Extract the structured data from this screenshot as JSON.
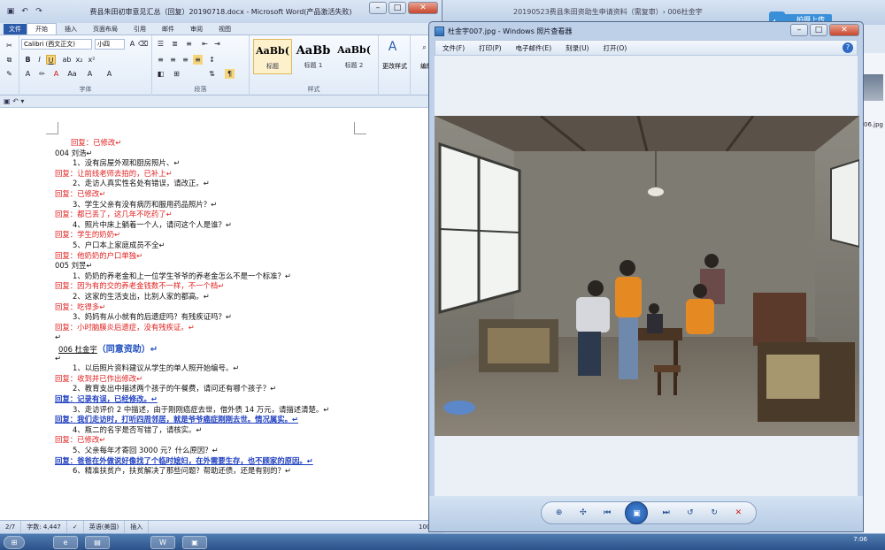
{
  "word": {
    "title": "费县朱田初审意见汇总（回复）20190718.docx - Microsoft Word(产品激活失败)",
    "qat_icons": [
      "save-icon",
      "undo-icon",
      "redo-icon"
    ],
    "tabs": [
      "文件",
      "开始",
      "插入",
      "页面布局",
      "引用",
      "邮件",
      "审阅",
      "视图"
    ],
    "active_tab": "开始",
    "font_name": "Calibri (西文正文)",
    "font_size": "小四",
    "groups": {
      "font": "字体",
      "paragraph": "段落",
      "styles": "样式",
      "change_styles": "更改样式",
      "edit": "编辑"
    },
    "styles": [
      {
        "sample": "AaBb(",
        "name": "标题"
      },
      {
        "sample": "AaBb",
        "name": "标题 1"
      },
      {
        "sample": "AaBb(",
        "name": "标题 2"
      }
    ],
    "doc_lines": [
      {
        "style": "red",
        "indent": 80,
        "text": "回复：已修改↵"
      },
      {
        "style": "black",
        "indent": 62,
        "text": "004 刘浩↵"
      },
      {
        "style": "black",
        "indent": 82,
        "text": "1、没有房屋外观和厨房照片、↵"
      },
      {
        "style": "red",
        "indent": 62,
        "text": "回复：让前线老师去拍的，已补上↵"
      },
      {
        "style": "black",
        "indent": 82,
        "text": "2、走访人真实性名处有错误，请改正。↵"
      },
      {
        "style": "red",
        "indent": 62,
        "text": "回复：已修改↵"
      },
      {
        "style": "black",
        "indent": 82,
        "text": "3、学生父亲有没有病历和服用药品照片？↵"
      },
      {
        "style": "red",
        "indent": 62,
        "text": "回复：都已丢了，这几年不吃药了↵"
      },
      {
        "style": "black",
        "indent": 82,
        "text": "4、照片中床上躺着一个人，请问这个人是谁？↵"
      },
      {
        "style": "red",
        "indent": 62,
        "text": "回复：学生的奶奶↵"
      },
      {
        "style": "black",
        "indent": 82,
        "text": "5、户口本上家庭成员不全↵"
      },
      {
        "style": "red",
        "indent": 62,
        "text": "回复：他奶奶的户口单独↵"
      },
      {
        "style": "black",
        "indent": 62,
        "text": "005 刘昱↵"
      },
      {
        "style": "black",
        "indent": 82,
        "text": "1、奶奶的养老金和上一位学生爷爷的养老金怎么不是一个标准？↵"
      },
      {
        "style": "red",
        "indent": 62,
        "text": "回复：因为有的交的养老金钱数不一样，不一个档↵"
      },
      {
        "style": "black",
        "indent": 82,
        "text": "2、这家的生活支出，比别人家的都高。↵"
      },
      {
        "style": "red",
        "indent": 62,
        "text": "回复：吃得多↵"
      },
      {
        "style": "black",
        "indent": 82,
        "text": "3、妈妈有从小就有的后遗症吗？有残疾证吗？↵"
      },
      {
        "style": "red",
        "indent": 62,
        "text": "回复：小时脑膜炎后遗症，没有残疾证。↵"
      },
      {
        "style": "black",
        "indent": 62,
        "text": "↵"
      },
      {
        "style": "heading",
        "indent": 66,
        "name": "006 杜金宇",
        "text": "（同意资助）↵"
      },
      {
        "style": "black",
        "indent": 62,
        "text": "↵"
      },
      {
        "style": "black",
        "indent": 82,
        "text": "1、以后照片资料建议从学生的单人照开始编号。↵"
      },
      {
        "style": "red",
        "indent": 62,
        "text": "回复：收到并已作出修改↵"
      },
      {
        "style": "black",
        "indent": 82,
        "text": "2、教育支出中描述两个孩子的午餐费，请问还有哪个孩子？↵"
      },
      {
        "style": "blue",
        "indent": 62,
        "text": "回复：记录有误，已经修改。↵"
      },
      {
        "style": "black",
        "indent": 82,
        "text": "3、走访评价 2 中描述，由于刚刚癌症去世，借外债 14 万元，请描述清楚。↵"
      },
      {
        "style": "blue",
        "indent": 62,
        "text": "回复：我们走访时，打听四周邻居，就是爷爷癌症刚刚去世。情况属实。↵"
      },
      {
        "style": "black",
        "indent": 82,
        "text": "4、瓶二的名字是否写错了，请核实。↵"
      },
      {
        "style": "red",
        "indent": 62,
        "text": "回复：已修改↵"
      },
      {
        "style": "black",
        "indent": 82,
        "text": "5、父亲每年才寄回 3000 元？什么原因？↵"
      },
      {
        "style": "blue",
        "indent": 62,
        "text": "回复：爸爸在外做说好像找了个临时媳妇，在外需要生存，也不顾家的原因。↵"
      },
      {
        "style": "black",
        "indent": 82,
        "text": "6、精准扶贫户，扶贫解决了那些问题？帮助还债，还是有别的？↵"
      }
    ],
    "status": {
      "page": "2/7",
      "words": "字数: 4,447",
      "lang": "英语(美国)",
      "mode": "插入",
      "zoom": "100%"
    }
  },
  "background_window": {
    "title": "20190523费县朱田资助生申请资料（需复审）› 006杜金宇",
    "cloud_button": "拍摄上传",
    "thumb_label": "006.jpg"
  },
  "viewer": {
    "title": "杜金宇007.jpg - Windows 照片查看器",
    "menu": [
      "文件(F)",
      "打印(P)",
      "电子邮件(E)",
      "刻录(U)",
      "打开(O)"
    ],
    "help": "?",
    "controls": [
      "zoom-icon",
      "fit-icon",
      "prev-icon",
      "slideshow-icon",
      "next-icon",
      "rotate-ccw-icon",
      "rotate-cw-icon",
      "delete-icon"
    ]
  },
  "taskbar": {
    "clock": "7:06"
  }
}
